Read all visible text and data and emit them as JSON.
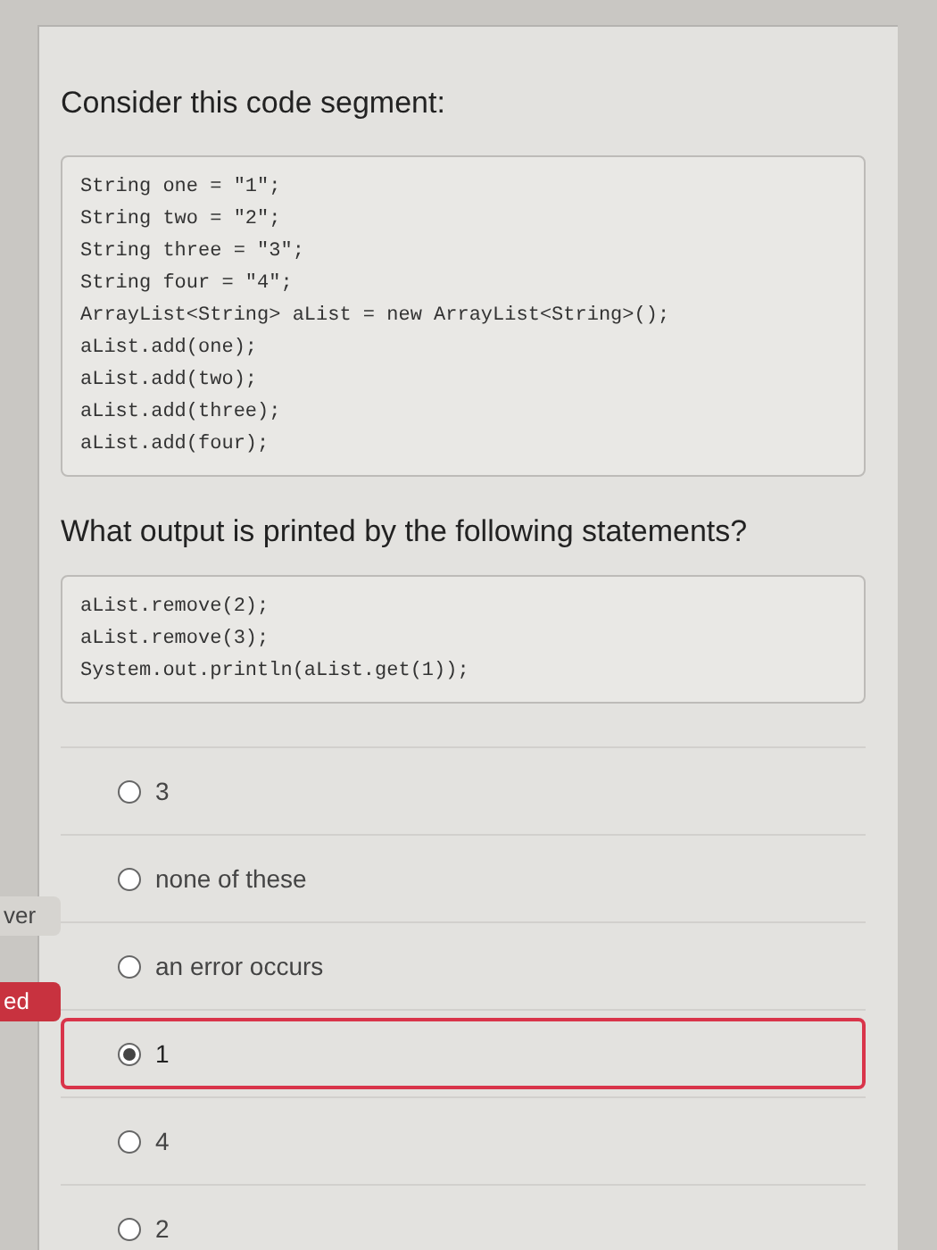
{
  "question": {
    "prompt": "Consider this code segment:",
    "code": [
      "String one = \"1\";",
      "String two = \"2\";",
      "String three = \"3\";",
      "String four = \"4\";",
      "ArrayList<String> aList = new ArrayList<String>();",
      "aList.add(one);",
      "aList.add(two);",
      "aList.add(three);",
      "aList.add(four);"
    ],
    "followup": "What output is printed by the following statements?",
    "followup_code": [
      "aList.remove(2);",
      "aList.remove(3);",
      "System.out.println(aList.get(1));"
    ]
  },
  "side_tags": [
    {
      "text": "ver",
      "kind": "neutral"
    },
    {
      "text": "ed",
      "kind": "alert"
    }
  ],
  "options": [
    {
      "label": "3",
      "selected": false,
      "marked_wrong": false
    },
    {
      "label": "none of these",
      "selected": false,
      "marked_wrong": false
    },
    {
      "label": "an error occurs",
      "selected": false,
      "marked_wrong": false
    },
    {
      "label": "1",
      "selected": true,
      "marked_wrong": true
    },
    {
      "label": "4",
      "selected": false,
      "marked_wrong": false
    },
    {
      "label": "2",
      "selected": false,
      "marked_wrong": false
    }
  ]
}
